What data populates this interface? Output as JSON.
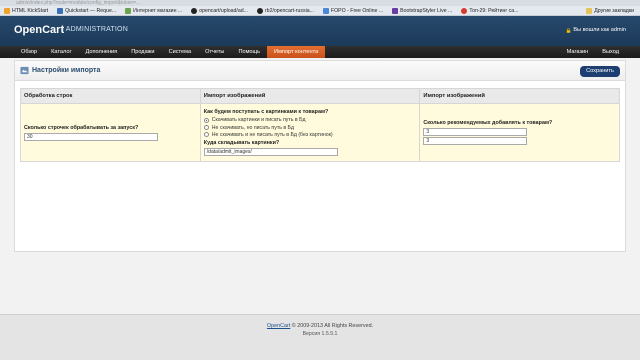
{
  "browser": {
    "url_text": "admin/index.php?route=module/config_import&token=...",
    "bookmarks": [
      {
        "label": "HTML KickStart",
        "color": "#f0a22a"
      },
      {
        "label": "Quickstart — Reque...",
        "color": "#3b6fb6"
      },
      {
        "label": "Интернет магазин ...",
        "color": "#6fa34b"
      },
      {
        "label": "opencart/upload/ad...",
        "color": "#222222"
      },
      {
        "label": "rb2/opencart-russia...",
        "color": "#222222"
      },
      {
        "label": "FOPO - Free Online ...",
        "color": "#4b86d8"
      },
      {
        "label": "BootstrapStyler Live ...",
        "color": "#6a3ea1"
      },
      {
        "label": "Топ-29: Рейтинг са...",
        "color": "#d63a2a"
      }
    ],
    "other_bookmarks": "Другие закладки"
  },
  "header": {
    "logo": "OpenCart",
    "subtitle": "| ADMINISTRATION",
    "logged_in": "Вы вошли как admin"
  },
  "menu": {
    "items": [
      "Обзор",
      "Каталог",
      "Дополнения",
      "Продажи",
      "Система",
      "Отчеты",
      "Помощь",
      "Импорт контента"
    ],
    "active_index": 7,
    "right_items": [
      "Магазин",
      "Выход"
    ]
  },
  "page": {
    "title": "Настройки импорта",
    "save_button": "Сохранить"
  },
  "settings": {
    "headers": [
      "Обработка строк",
      "Импорт изображений",
      "Импорт изображений"
    ],
    "rows_label": "Сколько строчек обрабатывать за запуск?",
    "rows_value": "30",
    "images_question": "Как будем поступать с картинками к товарам?",
    "image_options": [
      "Скачивать картинки и писать путь в Бд",
      "Не скачивать, но писать путь в Бд",
      "Не скачивать и не писать путь в Бд (без картинок)"
    ],
    "image_option_selected": 0,
    "folder_label": "Куда складывать картинки?",
    "folder_value": "/data/admit_images/",
    "recommended_label": "Сколько рекомендуемых добавлять к товарам?",
    "recommended_value": "3",
    "recommended_value2": "3"
  },
  "footer": {
    "link": "OpenCart",
    "copyright": " © 2009-2013 All Rights Reserved.",
    "version": "Версия 1.5.5.1"
  },
  "colors": {
    "header_bg": "#1f3f60",
    "menu_active": "#d65e25",
    "save_button": "#1d3e70",
    "table_cell": "#fffbdc"
  }
}
